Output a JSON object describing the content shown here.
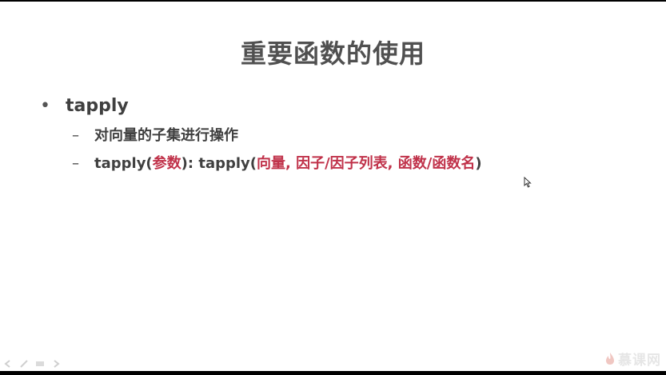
{
  "slide": {
    "title": "重要函数的使用",
    "bullet": {
      "marker": "•",
      "text": "tapply"
    },
    "sub_items": [
      {
        "marker": "–",
        "text": "对向量的子集进行操作"
      },
      {
        "marker": "–",
        "segments": [
          "tapply(",
          "参数",
          "): tapply(",
          "向量, 因子/因子列表, 函数/函数名",
          ")"
        ]
      }
    ]
  },
  "watermark": {
    "text": "慕课网"
  },
  "colors": {
    "accent_red": "#c0324a",
    "text": "#404040",
    "title": "#505050"
  },
  "icons": {
    "cursor": "mouse-cursor-icon",
    "nav": [
      "prev-slide-icon",
      "pen-icon",
      "menu-icon",
      "next-slide-icon"
    ],
    "watermark_logo": "flame-logo-icon"
  }
}
